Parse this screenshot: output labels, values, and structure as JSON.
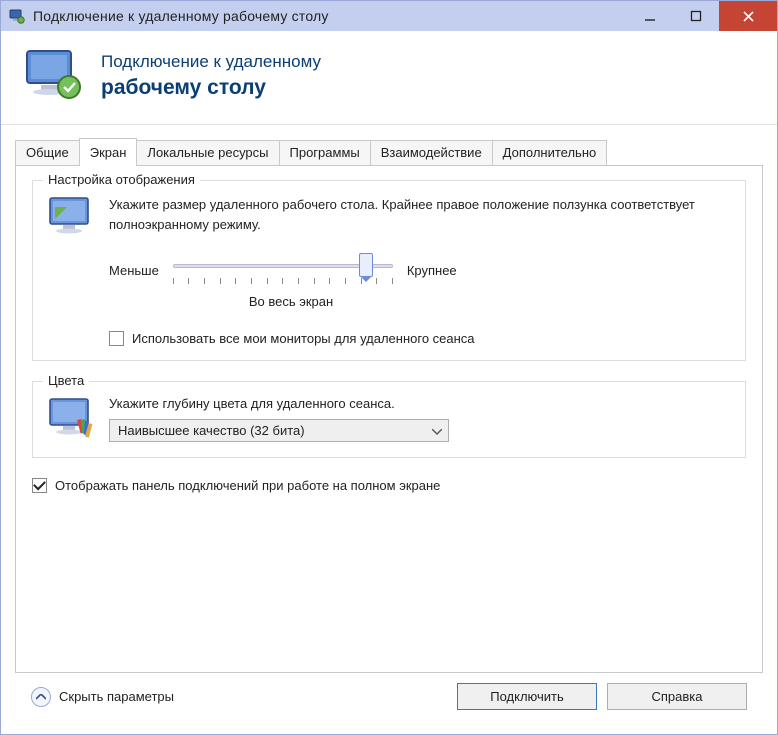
{
  "window": {
    "title": "Подключение к удаленному рабочему столу"
  },
  "banner": {
    "line1": "Подключение к удаленному",
    "line2": "рабочему столу"
  },
  "tabs": {
    "general": "Общие",
    "display": "Экран",
    "local": "Локальные ресурсы",
    "programs": "Программы",
    "experience": "Взаимодействие",
    "advanced": "Дополнительно",
    "active_index": 1
  },
  "display_tab": {
    "group_display": {
      "legend": "Настройка отображения",
      "desc": "Укажите размер удаленного рабочего стола. Крайнее правое положение ползунка соответствует полноэкранному режиму.",
      "slider_min_label": "Меньше",
      "slider_max_label": "Крупнее",
      "slider_value_percent": 88,
      "slider_caption": "Во весь экран",
      "checkbox_all_monitors": {
        "label": "Использовать все мои мониторы для удаленного сеанса",
        "checked": false
      }
    },
    "group_colors": {
      "legend": "Цвета",
      "desc": "Укажите глубину цвета для удаленного сеанса.",
      "combo_selected": "Наивысшее качество (32 бита)"
    }
  },
  "show_connection_bar": {
    "label": "Отображать панель подключений при работе на полном экране",
    "checked": true
  },
  "footer": {
    "hide_options": "Скрыть параметры",
    "connect": "Подключить",
    "help": "Справка"
  },
  "icons": {
    "app": "rdp-icon",
    "monitor": "monitor-icon",
    "monitor_colors": "monitor-palette-icon"
  }
}
